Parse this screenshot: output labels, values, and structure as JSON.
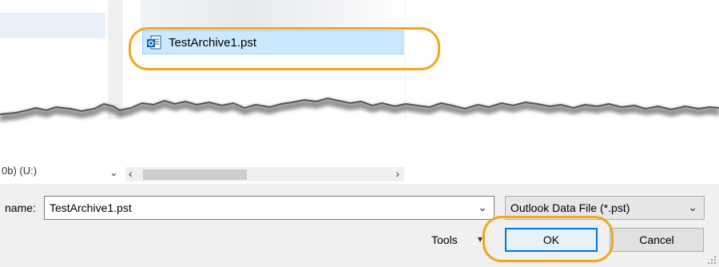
{
  "file_list": {
    "items": [
      {
        "name": "TestArchive1.pst",
        "icon": "outlook-data-file-icon"
      }
    ]
  },
  "location": {
    "drive_label": "0b) (U:)"
  },
  "dialog": {
    "file_name_label": "name:",
    "file_name_value": "TestArchive1.pst",
    "file_type_value": "Outlook Data File (*.pst)",
    "tools_label": "Tools",
    "ok_label": "OK",
    "cancel_label": "Cancel"
  },
  "colors": {
    "highlight": "#f0a81c",
    "selection": "#cce8ff",
    "primary_border": "#0078d7"
  }
}
